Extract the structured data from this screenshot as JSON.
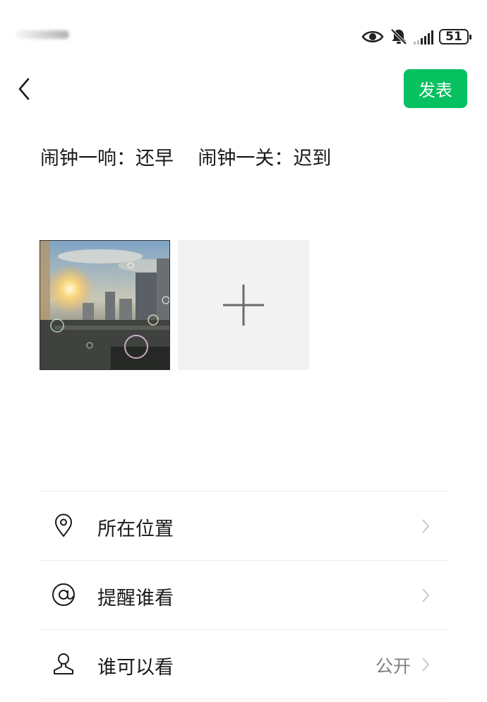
{
  "status_bar": {
    "battery_level": "51"
  },
  "header": {
    "publish_label": "发表"
  },
  "post": {
    "text": "闹钟一响：还早    闹钟一关：迟到"
  },
  "options": [
    {
      "label": "所在位置",
      "value": "",
      "icon": "location-icon"
    },
    {
      "label": "提醒谁看",
      "value": "",
      "icon": "at-icon"
    },
    {
      "label": "谁可以看",
      "value": "公开",
      "icon": "person-icon"
    }
  ],
  "colors": {
    "accent": "#07c160",
    "chevron": "#c8c8c8",
    "secondary_text": "#7f7f7f"
  }
}
